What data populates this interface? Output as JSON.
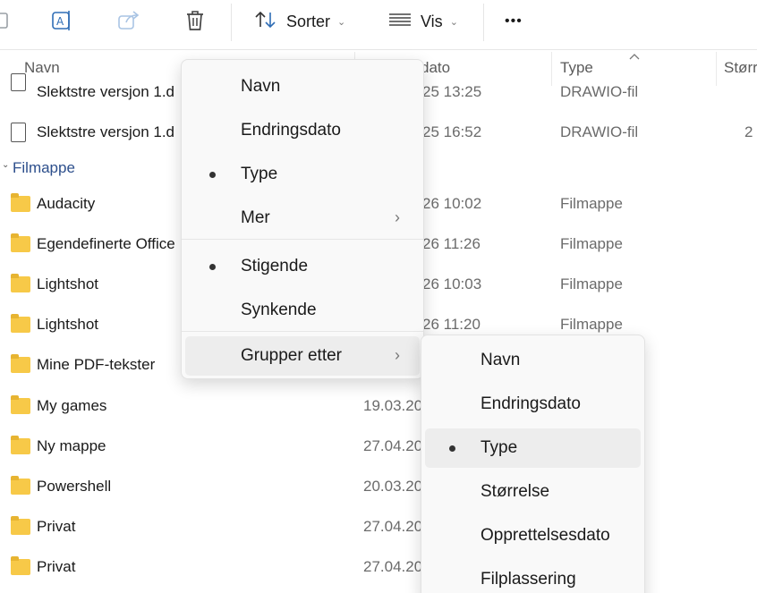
{
  "toolbar": {
    "sort_label": "Sorter",
    "view_label": "Vis",
    "more_label": "•••"
  },
  "columns": {
    "name": "Navn",
    "date": "dato",
    "type": "Type",
    "size": "Størr"
  },
  "files": [
    {
      "name": "Slektstre versjon 1.d",
      "date": "25 13:25",
      "type": "DRAWIO-fil",
      "size": ""
    },
    {
      "name": "Slektstre versjon 1.d",
      "date": "25 16:52",
      "type": "DRAWIO-fil",
      "size": "2"
    }
  ],
  "group": {
    "label": "Filmappe"
  },
  "folders": [
    {
      "name": "Audacity",
      "date": "26 10:02",
      "type": "Filmappe"
    },
    {
      "name": "Egendefinerte Office",
      "date": "26 11:26",
      "type": "Filmappe"
    },
    {
      "name": "Lightshot",
      "date": "26 10:03",
      "type": "Filmappe"
    },
    {
      "name": "Lightshot",
      "date": "26 11:20",
      "type": "Filmappe"
    },
    {
      "name": "Mine PDF-tekster",
      "date": "",
      "type": ""
    },
    {
      "name": "My games",
      "date": "19.03.20",
      "type": ""
    },
    {
      "name": "Ny mappe",
      "date": "27.04.20",
      "type": ""
    },
    {
      "name": "Powershell",
      "date": "20.03.20",
      "type": ""
    },
    {
      "name": "Privat",
      "date": "27.04.20",
      "type": ""
    },
    {
      "name": "Privat",
      "date": "27.04.20",
      "type": ""
    }
  ],
  "sort_menu": {
    "items": [
      "Navn",
      "Endringsdato",
      "Type",
      "Mer",
      "Stigende",
      "Synkende",
      "Grupper etter"
    ],
    "selected_field": "Type",
    "selected_order": "Stigende"
  },
  "group_menu": {
    "items": [
      "Navn",
      "Endringsdato",
      "Type",
      "Størrelse",
      "Opprettelsesdato",
      "Filplassering"
    ],
    "selected": "Type"
  },
  "colors": {
    "folder": "#f7c948",
    "group_header": "#2d4f8c",
    "menu_bg": "#f9f9f9",
    "menu_highlight": "#ededed"
  }
}
